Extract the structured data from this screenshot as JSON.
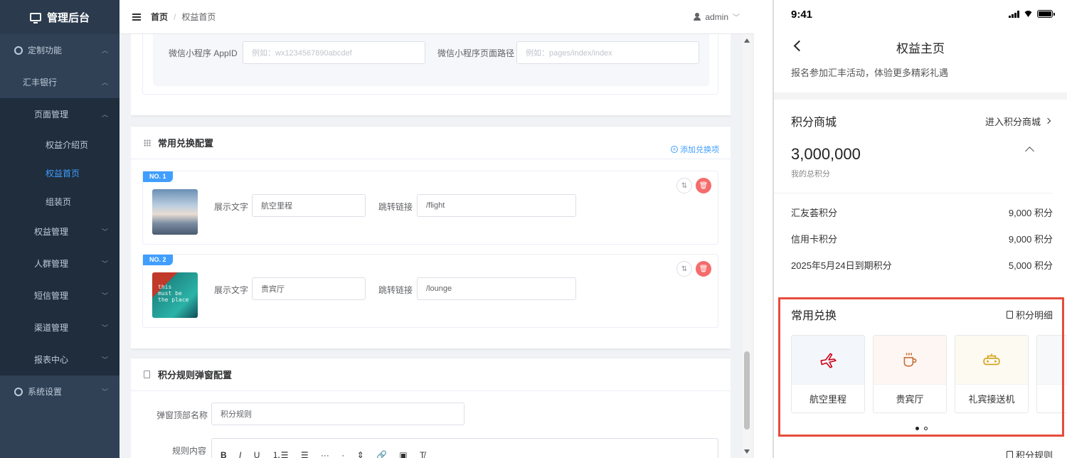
{
  "sidebar": {
    "logo": "管理后台",
    "items": [
      {
        "label": "定制功能",
        "level": 0,
        "icon": "gear-icon",
        "chevron": "up"
      },
      {
        "label": "汇丰银行",
        "level": 1,
        "chevron": "up"
      },
      {
        "label": "页面管理",
        "level": 2,
        "chevron": "up"
      },
      {
        "label": "权益介绍页",
        "level": 3
      },
      {
        "label": "权益首页",
        "level": 3,
        "active": true
      },
      {
        "label": "组装页",
        "level": 3
      },
      {
        "label": "权益管理",
        "level": 2,
        "chevron": "down"
      },
      {
        "label": "人群管理",
        "level": 2,
        "chevron": "down"
      },
      {
        "label": "短信管理",
        "level": 2,
        "chevron": "down"
      },
      {
        "label": "渠道管理",
        "level": 2,
        "chevron": "down"
      },
      {
        "label": "报表中心",
        "level": 2,
        "chevron": "down"
      },
      {
        "label": "系统设置",
        "level": 0,
        "icon": "gear-icon",
        "chevron": "down"
      }
    ]
  },
  "navbar": {
    "breadcrumb_home": "首页",
    "breadcrumb_sep": "/",
    "breadcrumb_current": "权益首页",
    "user": "admin"
  },
  "miniprogram": {
    "appid_label": "微信小程序 AppID",
    "appid_placeholder": "例如：wx1234567890abcdef",
    "path_label": "微信小程序页面路径",
    "path_placeholder": "例如：pages/index/index"
  },
  "exchange_config": {
    "title": "常用兑换配置",
    "add_label": "添加兑换项",
    "items": [
      {
        "badge": "NO. 1",
        "text_label": "展示文字",
        "text_value": "航空里程",
        "link_label": "跳转链接",
        "link_value": "/flight"
      },
      {
        "badge": "NO. 2",
        "text_label": "展示文字",
        "text_value": "贵宾厅",
        "link_label": "跳转链接",
        "link_value": "/lounge",
        "thumb_text": "this\nmust be\nthe place"
      }
    ]
  },
  "rules_config": {
    "title": "积分规则弹窗配置",
    "top_name_label": "弹窗顶部名称",
    "top_name_value": "积分规则",
    "content_label": "规则内容",
    "toolbar": [
      "B",
      "I",
      "U",
      "⒈☰",
      "☰",
      "···",
      "·",
      "⇕",
      "🔗",
      "▣",
      "T̸"
    ]
  },
  "phone": {
    "time": "9:41",
    "title": "权益主页",
    "subtitle": "报名参加汇丰活动，体验更多精彩礼遇",
    "mall_title": "积分商城",
    "mall_link": "进入积分商城",
    "total_points": "3,000,000",
    "total_points_label": "我的总积分",
    "point_rows": [
      {
        "label": "汇友荟积分",
        "value": "9,000 积分"
      },
      {
        "label": "信用卡积分",
        "value": "9,000 积分"
      },
      {
        "label": "2025年5月24日到期积分",
        "value": "5,000 积分"
      }
    ],
    "exchange_title": "常用兑换",
    "detail_link": "积分明细",
    "tiles": [
      {
        "label": "航空里程",
        "icon": "plane-icon",
        "bg": "#f3f7fc",
        "color": "#d0021b"
      },
      {
        "label": "贵宾厅",
        "icon": "coffee-cup-icon",
        "bg": "#fdf6f2",
        "color": "#c8703a"
      },
      {
        "label": "礼宾接送机",
        "icon": "car-icon",
        "bg": "#fdfaf1",
        "color": "#d4a017"
      }
    ],
    "rules_link": "积分规则"
  },
  "colors": {
    "accent": "#409eff",
    "danger": "#f56c6c",
    "highlight": "#e74c3c",
    "sidebar": "#304156"
  }
}
